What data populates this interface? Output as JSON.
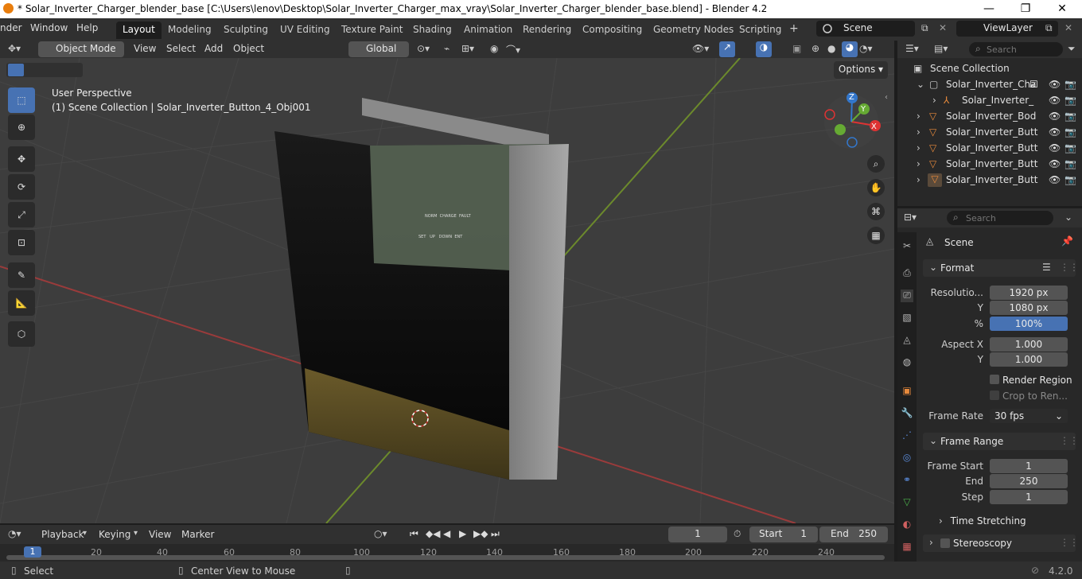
{
  "window": {
    "title": "* Solar_Inverter_Charger_blender_base [C:\\Users\\lenov\\Desktop\\Solar_Inverter_Charger_max_vray\\Solar_Inverter_Charger_blender_base.blend] - Blender 4.2",
    "minimize": "—",
    "maximize": "❐",
    "close": "✕"
  },
  "menubar": {
    "items": [
      "nder",
      "Window",
      "Help"
    ]
  },
  "workspaces": {
    "tabs": [
      "Layout",
      "Modeling",
      "Sculpting",
      "UV Editing",
      "Texture Paint",
      "Shading",
      "Animation",
      "Rendering",
      "Compositing",
      "Geometry Nodes",
      "Scripting"
    ],
    "add": "+"
  },
  "scene": {
    "name": "Scene",
    "viewlayer": "ViewLayer"
  },
  "viewport_header": {
    "mode": "Object Mode",
    "menus": [
      "View",
      "Select",
      "Add",
      "Object"
    ],
    "transform": "Global",
    "options": "Options"
  },
  "viewport": {
    "perspective": "User Perspective",
    "context": "(1) Scene Collection | Solar_Inverter_Button_4_Obj001",
    "gizmo": {
      "z": "Z",
      "y": "Y",
      "x": "X"
    },
    "panel_labels": [
      "NORM",
      "CHARGE",
      "FAULT"
    ],
    "button_labels": [
      "SET",
      "UP",
      "DOWN",
      "ENT"
    ]
  },
  "outliner": {
    "search_placeholder": "Search",
    "root": "Scene Collection",
    "rows": [
      "Solar_Inverter_Cha",
      "Solar_Inverter_",
      "Solar_Inverter_Bod",
      "Solar_Inverter_Butt",
      "Solar_Inverter_Butt",
      "Solar_Inverter_Butt",
      "Solar_Inverter_Butt"
    ]
  },
  "properties": {
    "search_placeholder": "Search",
    "context": "Scene",
    "format": {
      "title": "Format",
      "resolution_label": "Resolutio...",
      "res_x": "1920 px",
      "y_label": "Y",
      "res_y": "1080 px",
      "pct_label": "%",
      "pct": "100%",
      "aspect_label": "Aspect X",
      "aspect_x": "1.000",
      "aspect_y_label": "Y",
      "aspect_y": "1.000",
      "render_region": "Render Region",
      "crop": "Crop to Ren...",
      "frame_rate_label": "Frame Rate",
      "frame_rate": "30 fps"
    },
    "frame_range": {
      "title": "Frame Range",
      "start_label": "Frame Start",
      "start": "1",
      "end_label": "End",
      "end": "250",
      "step_label": "Step",
      "step": "1",
      "time_stretching": "Time Stretching"
    },
    "stereoscopy": "Stereoscopy"
  },
  "timeline": {
    "menus": [
      "Playback",
      "Keying",
      "View",
      "Marker"
    ],
    "current": "1",
    "start_label": "Start",
    "start": "1",
    "end_label": "End",
    "end": "250",
    "ticks": [
      "1",
      "20",
      "40",
      "60",
      "80",
      "100",
      "120",
      "140",
      "160",
      "180",
      "200",
      "220",
      "240"
    ]
  },
  "statusbar": {
    "select": "Select",
    "center": "Center View to Mouse",
    "version": "4.2.0"
  }
}
